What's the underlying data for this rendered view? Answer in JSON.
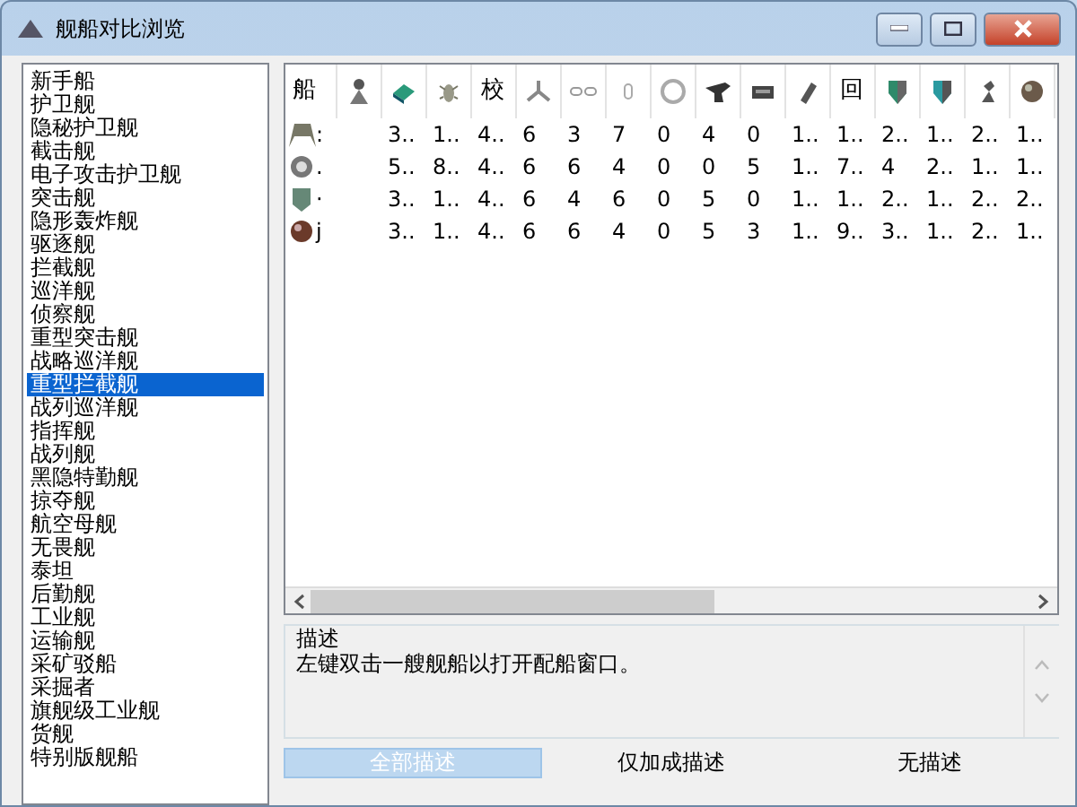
{
  "window": {
    "title": "舰船对比浏览"
  },
  "ship_classes": [
    {
      "label": "新手船",
      "selected": false
    },
    {
      "label": "护卫舰",
      "selected": false
    },
    {
      "label": "隐秘护卫舰",
      "selected": false
    },
    {
      "label": "截击舰",
      "selected": false
    },
    {
      "label": "电子攻击护卫舰",
      "selected": false
    },
    {
      "label": "突击舰",
      "selected": false
    },
    {
      "label": "隐形轰炸舰",
      "selected": false
    },
    {
      "label": "驱逐舰",
      "selected": false
    },
    {
      "label": "拦截舰",
      "selected": false
    },
    {
      "label": "巡洋舰",
      "selected": false
    },
    {
      "label": "侦察舰",
      "selected": false
    },
    {
      "label": "重型突击舰",
      "selected": false
    },
    {
      "label": "战略巡洋舰",
      "selected": false
    },
    {
      "label": "重型拦截舰",
      "selected": true
    },
    {
      "label": "战列巡洋舰",
      "selected": false
    },
    {
      "label": "指挥舰",
      "selected": false
    },
    {
      "label": "战列舰",
      "selected": false
    },
    {
      "label": "黑隐特勤舰",
      "selected": false
    },
    {
      "label": "掠夺舰",
      "selected": false
    },
    {
      "label": "航空母舰",
      "selected": false
    },
    {
      "label": "无畏舰",
      "selected": false
    },
    {
      "label": "泰坦",
      "selected": false
    },
    {
      "label": "后勤舰",
      "selected": false
    },
    {
      "label": "工业舰",
      "selected": false
    },
    {
      "label": "运输舰",
      "selected": false
    },
    {
      "label": "采矿驳船",
      "selected": false
    },
    {
      "label": "采掘者",
      "selected": false
    },
    {
      "label": "旗舰级工业舰",
      "selected": false
    },
    {
      "label": "货舰",
      "selected": false
    },
    {
      "label": "特别版舰船",
      "selected": false
    }
  ],
  "table": {
    "columns": [
      {
        "kind": "text",
        "label": "船"
      },
      {
        "kind": "icon"
      },
      {
        "kind": "icon"
      },
      {
        "kind": "icon"
      },
      {
        "kind": "text",
        "label": "校"
      },
      {
        "kind": "icon"
      },
      {
        "kind": "icon"
      },
      {
        "kind": "icon"
      },
      {
        "kind": "icon"
      },
      {
        "kind": "icon"
      },
      {
        "kind": "icon"
      },
      {
        "kind": "icon"
      },
      {
        "kind": "text",
        "label": "回"
      },
      {
        "kind": "icon"
      },
      {
        "kind": "icon"
      },
      {
        "kind": "icon"
      },
      {
        "kind": "icon"
      }
    ],
    "rows": [
      {
        "name": ":",
        "values": [
          "3..",
          "1..",
          "4..",
          "6",
          "3",
          "7",
          "0",
          "4",
          "0",
          "1..",
          "1..",
          "2..",
          "1..",
          "2..",
          "1.."
        ]
      },
      {
        "name": ".",
        "values": [
          "5..",
          "8..",
          "4..",
          "6",
          "6",
          "4",
          "0",
          "0",
          "5",
          "1..",
          "7..",
          "4",
          "2..",
          "1..",
          "1.."
        ]
      },
      {
        "name": "·",
        "values": [
          "3..",
          "1..",
          "4..",
          "6",
          "4",
          "6",
          "0",
          "5",
          "0",
          "1..",
          "1..",
          "2..",
          "1..",
          "2..",
          "2.."
        ]
      },
      {
        "name": "j",
        "values": [
          "3..",
          "1..",
          "4..",
          "6",
          "6",
          "4",
          "0",
          "5",
          "3",
          "1..",
          "9..",
          "3..",
          "1..",
          "2..",
          "1.."
        ]
      }
    ]
  },
  "description": {
    "heading": "描述",
    "text": "左键双击一艘舰船以打开配船窗口。"
  },
  "buttons": [
    {
      "label": "全部描述",
      "selected": true
    },
    {
      "label": "仅加成描述",
      "selected": false
    },
    {
      "label": "无描述",
      "selected": false
    }
  ]
}
